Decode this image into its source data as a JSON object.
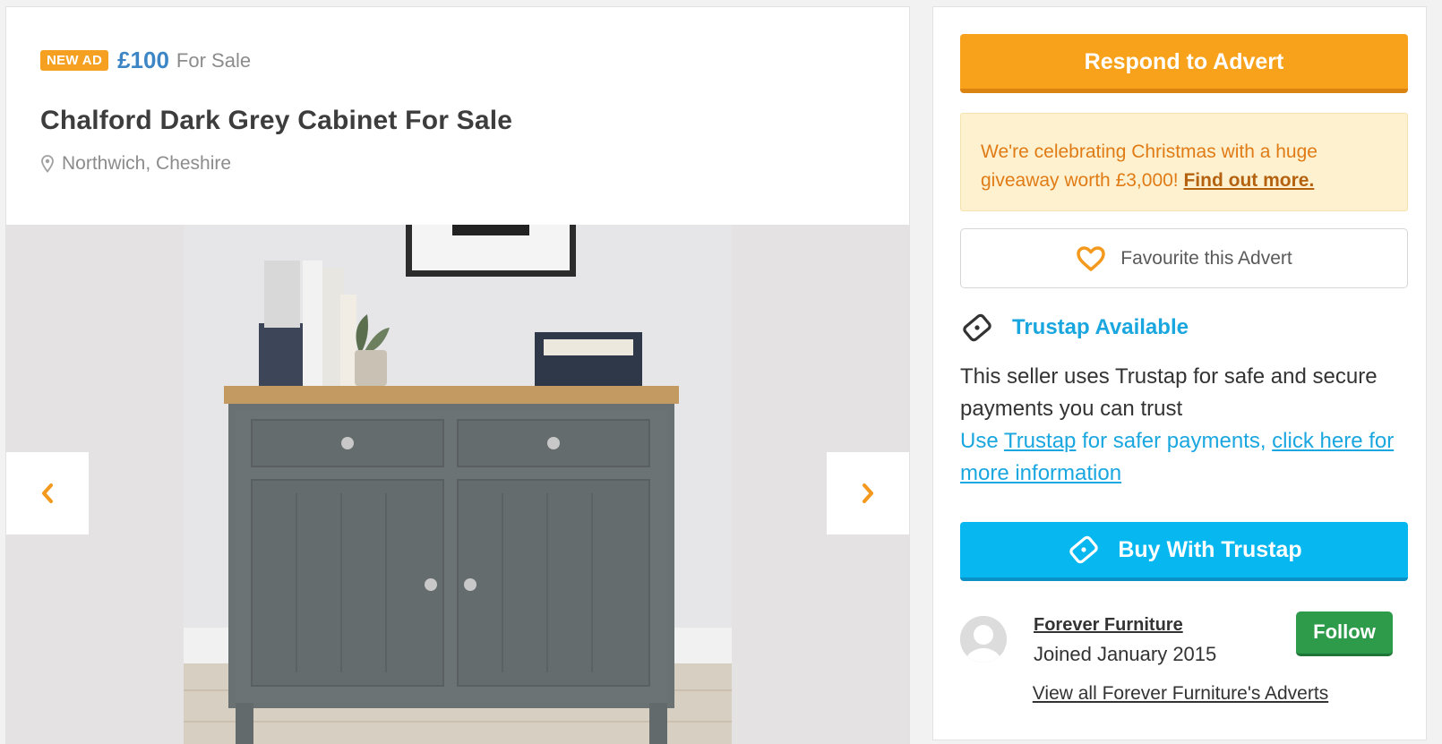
{
  "listing": {
    "badge": "NEW AD",
    "price": "£100",
    "sale_type": "For Sale",
    "title": "Chalford Dark Grey Cabinet For Sale",
    "location": "Northwich, Cheshire"
  },
  "gallery": {
    "prev_icon": "chevron-left-icon",
    "next_icon": "chevron-right-icon"
  },
  "sidebar": {
    "respond_label": "Respond to Advert",
    "promo_text": "We're celebrating Christmas with a huge giveaway worth £3,000!",
    "promo_link": "Find out more.",
    "favourite_label": "Favourite this Advert",
    "trustap_title": "Trustap Available",
    "trustap_text": "This seller uses Trustap for safe and secure payments you can trust",
    "trustap_use": "Use",
    "trustap_link": "Trustap",
    "trustap_mid": "for safer payments,",
    "trustap_info_link": "click here for more information",
    "buy_label": "Buy With Trustap",
    "seller_name": "Forever Furniture",
    "seller_joined": "Joined January 2015",
    "follow_label": "Follow",
    "view_all_label": "View all Forever Furniture's Adverts"
  },
  "colors": {
    "accent_orange": "#f8a21c",
    "price_blue": "#3d86c6",
    "trustap_blue": "#06b7f0",
    "follow_green": "#2e9b4b"
  }
}
